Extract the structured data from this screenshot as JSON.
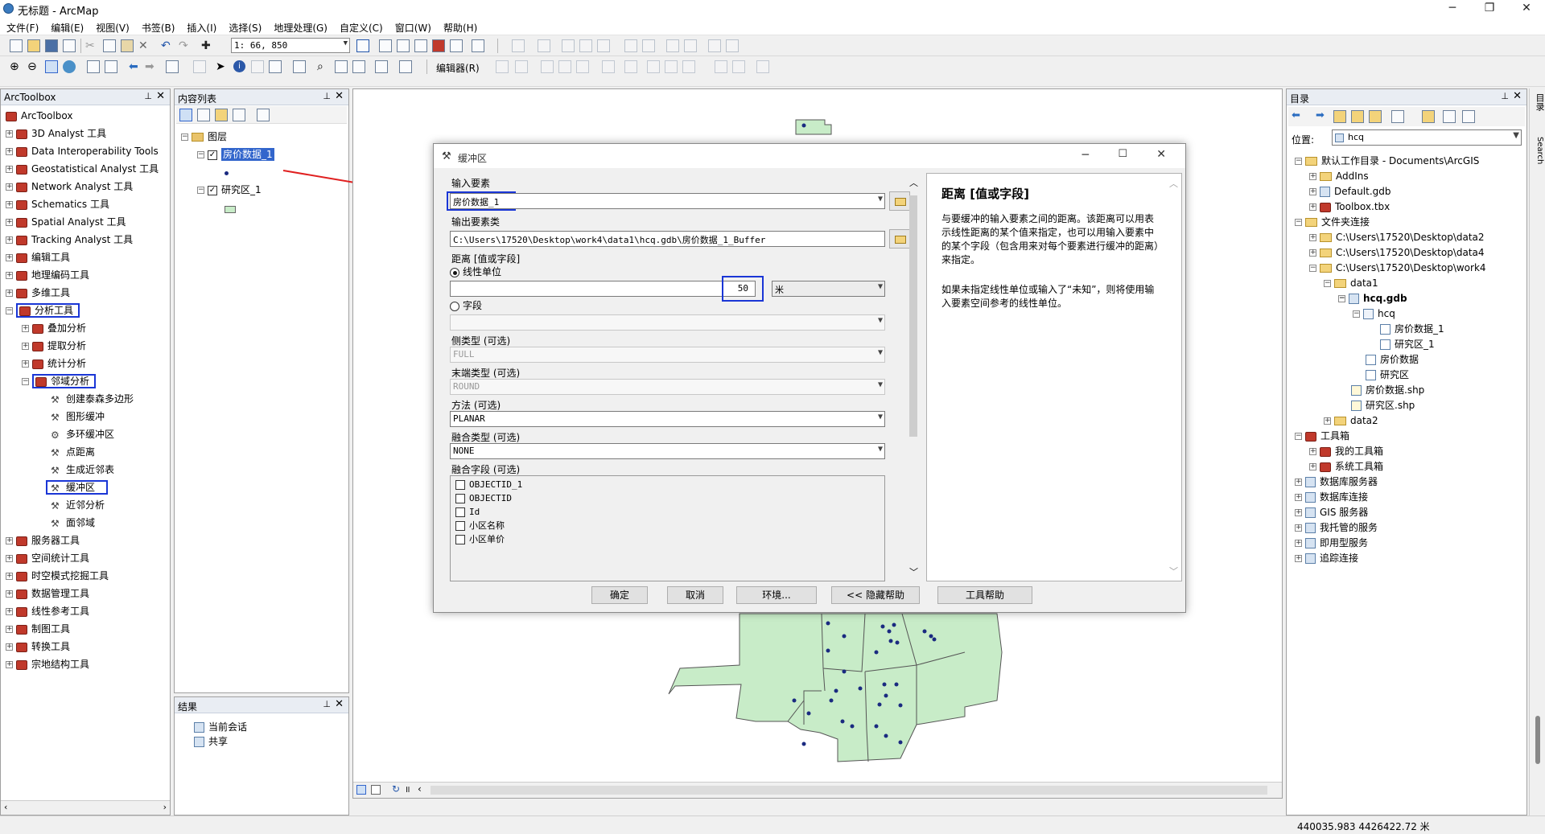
{
  "window": {
    "title": "无标题 - ArcMap"
  },
  "menu": [
    "文件(F)",
    "编辑(E)",
    "视图(V)",
    "书签(B)",
    "插入(I)",
    "选择(S)",
    "地理处理(G)",
    "自定义(C)",
    "窗口(W)",
    "帮助(H)"
  ],
  "toolbar": {
    "scale": "1: 66, 850",
    "editor": "编辑器(R)"
  },
  "arctoolbox": {
    "title": "ArcToolbox",
    "root": "ArcToolbox",
    "items": [
      "3D Analyst 工具",
      "Data Interoperability Tools",
      "Geostatistical Analyst 工具",
      "Network Analyst 工具",
      "Schematics 工具",
      "Spatial Analyst 工具",
      "Tracking Analyst 工具",
      "编辑工具",
      "地理编码工具",
      "多维工具",
      "分析工具"
    ],
    "analysis_sub": [
      "叠加分析",
      "提取分析",
      "统计分析",
      "邻域分析"
    ],
    "neighborhood_tools": [
      "创建泰森多边形",
      "图形缓冲",
      "多环缓冲区",
      "点距离",
      "生成近邻表",
      "缓冲区",
      "近邻分析",
      "面邻域"
    ],
    "items_after": [
      "服务器工具",
      "空间统计工具",
      "时空模式挖掘工具",
      "数据管理工具",
      "线性参考工具",
      "制图工具",
      "转换工具",
      "宗地结构工具"
    ]
  },
  "toc": {
    "title": "内容列表",
    "layers_label": "图层",
    "layer1": "房价数据_1",
    "layer2": "研究区_1"
  },
  "results": {
    "title": "结果",
    "items": [
      "当前会话",
      "共享"
    ]
  },
  "dialog": {
    "title": "缓冲区",
    "input_label": "输入要素",
    "input_value": "房价数据_1",
    "output_label": "输出要素类",
    "output_value": "C:\\Users\\17520\\Desktop\\work4\\data1\\hcq.gdb\\房价数据_1_Buffer",
    "distance_label": "距离 [值或字段]",
    "radio_linear": "线性单位",
    "distance_value": "50",
    "unit": "米",
    "radio_field": "字段",
    "side_label": "侧类型 (可选)",
    "side_value": "FULL",
    "end_label": "末端类型 (可选)",
    "end_value": "ROUND",
    "method_label": "方法 (可选)",
    "method_value": "PLANAR",
    "dissolve_label": "融合类型 (可选)",
    "dissolve_value": "NONE",
    "dfields_label": "融合字段 (可选)",
    "dfields": [
      "OBJECTID_1",
      "OBJECTID",
      "Id",
      "小区名称",
      "小区单价"
    ],
    "buttons": {
      "ok": "确定",
      "cancel": "取消",
      "env": "环境...",
      "hide": "<< 隐藏帮助",
      "toolhelp": "工具帮助"
    },
    "help_title": "距离 [值或字段]",
    "help_p1": "与要缓冲的输入要素之间的距离。该距离可以用表示线性距离的某个值来指定，也可以用输入要素中的某个字段（包含用来对每个要素进行缓冲的距离）来指定。",
    "help_p2": "如果未指定线性单位或输入了“未知”，则将使用输入要素空间参考的线性单位。"
  },
  "catalog": {
    "title": "目录",
    "location_label": "位置:",
    "location_value": "hcq",
    "side_tabs": [
      "目录",
      "Search"
    ],
    "tree": {
      "home": "默认工作目录 - Documents\\ArcGIS",
      "addins": "AddIns",
      "default_gdb": "Default.gdb",
      "toolbox": "Toolbox.tbx",
      "folder_conn": "文件夹连接",
      "data2_path": "C:\\Users\\17520\\Desktop\\data2",
      "data4_path": "C:\\Users\\17520\\Desktop\\data4",
      "work4_path": "C:\\Users\\17520\\Desktop\\work4",
      "data1": "data1",
      "hcq_gdb": "hcq.gdb",
      "hcq": "hcq",
      "fjsj1": "房价数据_1",
      "yjq1": "研究区_1",
      "fjsj": "房价数据",
      "yjq": "研究区",
      "fjsj_shp": "房价数据.shp",
      "yjq_shp": "研究区.shp",
      "data2": "data2",
      "toolboxes": "工具箱",
      "my_tb": "我的工具箱",
      "sys_tb": "系统工具箱",
      "db_servers": "数据库服务器",
      "db_conn": "数据库连接",
      "gis_servers": "GIS 服务器",
      "hosted": "我托管的服务",
      "ready": "即用型服务",
      "tracking": "追踪连接"
    }
  },
  "status": {
    "coords": "440035.983  4426422.72 米"
  },
  "colors": {
    "highlight": "#1a36d6",
    "arrow": "#e02020",
    "polygon": "#c8ecc8",
    "point": "#1a2a80",
    "selection": "#3366cc"
  }
}
